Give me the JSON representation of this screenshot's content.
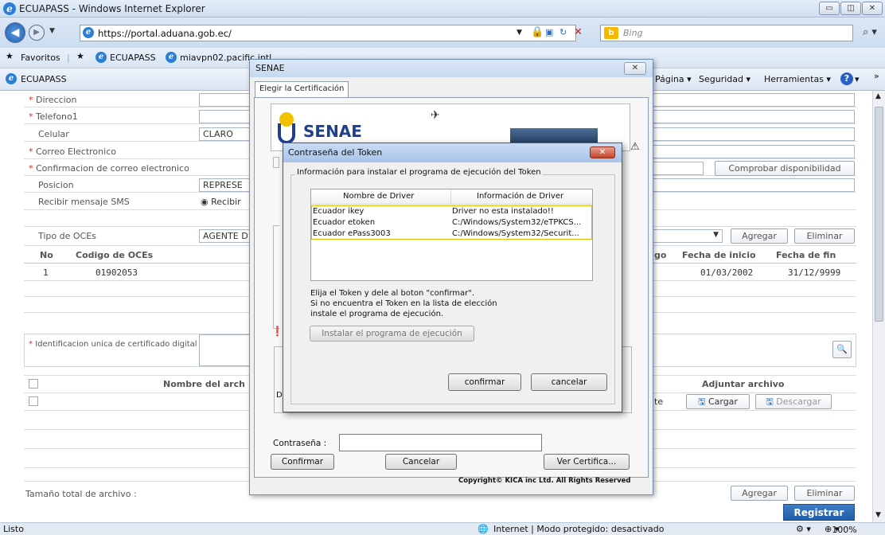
{
  "browser": {
    "title": "ECUAPASS - Windows Internet Explorer",
    "url": "https://portal.aduana.gob.ec/",
    "search_placeholder": "Bing",
    "favorites_label": "Favoritos",
    "fav_links": [
      "ECUAPASS",
      "miavpn02.pacific.intl"
    ],
    "tab_label": "ECUAPASS",
    "menus": [
      "Página ▾",
      "Seguridad ▾",
      "Herramientas ▾"
    ],
    "status_left": "Listo",
    "status_mode": "Internet | Modo protegido: desactivado",
    "zoom": "100%"
  },
  "form": {
    "direccion": "Direccion",
    "telefono1": "Telefono1",
    "celular": "Celular",
    "celular_value": "CLARO",
    "correo": "Correo Electronico",
    "confirm_correo": "Confirmacion de correo electronico",
    "comprobar": "Comprobar disponibilidad",
    "posicion": "Posicion",
    "posicion_value": "REPRESE",
    "sms": "Recibir mensaje SMS",
    "sms_option": "Recibir",
    "tipo_oce": "Tipo de OCEs",
    "tipo_oce_value": "AGENTE D",
    "agregar": "Agregar",
    "eliminar": "Eliminar",
    "oce_headers": [
      "No",
      "Codigo de OCEs",
      "go",
      "Fecha de inicio",
      "Fecha de fin"
    ],
    "oce_row": [
      "1",
      "01902053",
      "01/03/2002",
      "31/12/9999"
    ],
    "ident_label": "Identificacion unica de certificado digital",
    "file_header": "Nombre del arch",
    "adjuntar": "Adjuntar archivo",
    "te": "te",
    "cargar": "Cargar",
    "descargar": "Descargar",
    "tamano": "Tamaño total de archivo :",
    "agregar2": "Agregar",
    "eliminar2": "Eliminar",
    "registrar": "Registrar"
  },
  "senae": {
    "title": "SENAE",
    "tab": "Elegir la Certificación",
    "logo_text": "SENAE",
    "password_label": "Contraseña :",
    "confirmar": "Confirmar",
    "cancelar": "Cancelar",
    "ver_cert": "Ver Certifica...",
    "copyright": "Copyright© KICA inc Ltd. All Rights Reserved"
  },
  "token": {
    "title": "Contraseña del Token",
    "group": "Información para instalar el programa de ejecución del Token",
    "col1": "Nombre de Driver",
    "col2": "Información de Driver",
    "drivers": [
      {
        "name": "Ecuador ikey",
        "info": "Driver no esta instalado!!"
      },
      {
        "name": "Ecuador etoken",
        "info": "C:/Windows/System32/eTPKCS..."
      },
      {
        "name": "Ecuador ePass3003",
        "info": "C:/Windows/System32/Securit..."
      }
    ],
    "instr1": "Elija el Token y dele al boton \"confirmar\".",
    "instr2": "Si no encuentra el Token en la lista de elección",
    "instr3": "instale el programa de ejecución.",
    "install_btn": "Instalar el programa de ejecución",
    "confirmar": "confirmar",
    "cancelar": "cancelar"
  }
}
